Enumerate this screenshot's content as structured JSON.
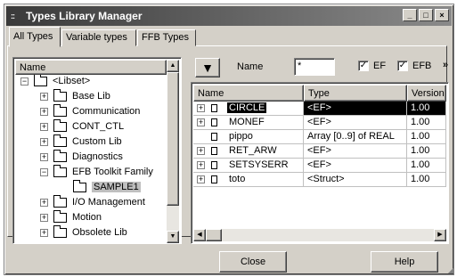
{
  "window": {
    "title": "Types Library Manager",
    "icon": "library-icon"
  },
  "tabs": [
    {
      "label": "All Types",
      "active": true
    },
    {
      "label": "Variable types",
      "active": false
    },
    {
      "label": "FFB Types",
      "active": false
    }
  ],
  "tree": {
    "header": "Name",
    "items": [
      {
        "label": "<Libset>",
        "expander": "−",
        "level": 0
      },
      {
        "label": "Base Lib",
        "expander": "+",
        "level": 1
      },
      {
        "label": "Communication",
        "expander": "+",
        "level": 1
      },
      {
        "label": "CONT_CTL",
        "expander": "+",
        "level": 1
      },
      {
        "label": "Custom Lib",
        "expander": "+",
        "level": 1
      },
      {
        "label": "Diagnostics",
        "expander": "+",
        "level": 1
      },
      {
        "label": "EFB Toolkit Family",
        "expander": "−",
        "level": 1
      },
      {
        "label": "SAMPLE1",
        "expander": "",
        "level": 2,
        "selected": true
      },
      {
        "label": "I/O Management",
        "expander": "+",
        "level": 1
      },
      {
        "label": "Motion",
        "expander": "+",
        "level": 1
      },
      {
        "label": "Obsolete Lib",
        "expander": "+",
        "level": 1
      }
    ]
  },
  "filter": {
    "name_label": "Name",
    "name_value": "*",
    "ef_label": "EF",
    "ef_checked": "✓",
    "efb_label": "EFB",
    "efb_checked": "✓",
    "more": "»"
  },
  "grid": {
    "columns": [
      "Name",
      "Type",
      "Version"
    ],
    "rows": [
      {
        "expander": "+",
        "name": "CIRCLE",
        "type": "<EF>",
        "version": "1.00",
        "selected": true
      },
      {
        "expander": "+",
        "name": "MONEF",
        "type": "<EF>",
        "version": "1.00"
      },
      {
        "expander": "",
        "name": "pippo",
        "type": "Array [0..9] of REAL",
        "version": "1.00"
      },
      {
        "expander": "+",
        "name": "RET_ARW",
        "type": "<EF>",
        "version": "1.00"
      },
      {
        "expander": "+",
        "name": "SETSYSERR",
        "type": "<EF>",
        "version": "1.00"
      },
      {
        "expander": "+",
        "name": "toto",
        "type": "<Struct>",
        "version": "1.00"
      }
    ]
  },
  "footer": {
    "close_label": "Close",
    "help_label": "Help"
  },
  "titlebar_buttons": {
    "minimize": "_",
    "maximize": "□",
    "close": "×"
  },
  "scroll_glyphs": {
    "up": "▲",
    "down": "▼",
    "left": "◀",
    "right": "▶"
  }
}
